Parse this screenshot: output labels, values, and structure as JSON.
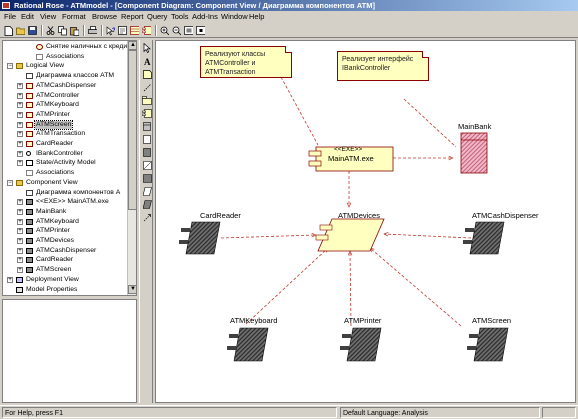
{
  "window": {
    "title": "Rational Rose - ATMmodel - [Component Diagram: Component View / Диаграмма компонентов ATM]"
  },
  "menu": [
    "File",
    "Edit",
    "View",
    "Format",
    "Browse",
    "Report",
    "Query",
    "Tools",
    "Add-Ins",
    "Window",
    "Help"
  ],
  "toolbar": {
    "buttons": [
      "new-icon",
      "open-icon",
      "save-icon",
      "cut-icon",
      "copy-icon",
      "paste-icon",
      "print-icon",
      "help-icon",
      "context-help-icon",
      "browse-icon",
      "class-diagram-icon",
      "component-diagram-icon",
      "zoom-in-icon",
      "zoom-out-icon",
      "fit-icon",
      "undo-fit-icon"
    ]
  },
  "browser": {
    "items": [
      {
        "label": "Снятие наличных с кредит",
        "level": 2,
        "icon": "usecase-icon"
      },
      {
        "label": "Associations",
        "level": 2,
        "icon": "association-icon"
      },
      {
        "label": "Logical View",
        "level": 0,
        "icon": "folder-icon",
        "expanded": true
      },
      {
        "label": "Диаграмма классов ATM",
        "level": 1,
        "icon": "class-diagram-icon"
      },
      {
        "label": "ATMCashDispenser",
        "level": 1,
        "icon": "class-icon"
      },
      {
        "label": "ATMController",
        "level": 1,
        "icon": "class-icon"
      },
      {
        "label": "ATMKeyboard",
        "level": 1,
        "icon": "class-icon"
      },
      {
        "label": "ATMPrinter",
        "level": 1,
        "icon": "class-icon"
      },
      {
        "label": "ATMScreen",
        "level": 1,
        "icon": "class-icon",
        "selected": true
      },
      {
        "label": "ATMTransaction",
        "level": 1,
        "icon": "class-icon"
      },
      {
        "label": "CardReader",
        "level": 1,
        "icon": "class-icon"
      },
      {
        "label": "IBankController",
        "level": 1,
        "icon": "interface-icon"
      },
      {
        "label": "State/Activity Model",
        "level": 1,
        "icon": "statechart-icon"
      },
      {
        "label": "Associations",
        "level": 1,
        "icon": "association-icon"
      },
      {
        "label": "Component View",
        "level": 0,
        "icon": "folder-icon",
        "expanded": true
      },
      {
        "label": "Диаграмма компонентов A",
        "level": 1,
        "icon": "component-diagram-icon"
      },
      {
        "label": "<<EXE>> MainATM.exe",
        "level": 1,
        "icon": "component-icon"
      },
      {
        "label": "MainBank",
        "level": 1,
        "icon": "component-icon"
      },
      {
        "label": "ATMKeyboard",
        "level": 1,
        "icon": "component-icon"
      },
      {
        "label": "ATMPrinter",
        "level": 1,
        "icon": "component-icon"
      },
      {
        "label": "ATMDevices",
        "level": 1,
        "icon": "component-icon"
      },
      {
        "label": "ATMCashDispenser",
        "level": 1,
        "icon": "component-icon"
      },
      {
        "label": "CardReader",
        "level": 1,
        "icon": "component-icon"
      },
      {
        "label": "ATMScreen",
        "level": 1,
        "icon": "component-icon"
      },
      {
        "label": "Deployment View",
        "level": 0,
        "icon": "deployment-icon"
      },
      {
        "label": "Model Properties",
        "level": 0,
        "icon": "properties-icon"
      }
    ]
  },
  "toolbox": [
    "selector-icon",
    "text-icon",
    "note-icon",
    "anchor-icon",
    "package-icon",
    "component-icon",
    "main-program-icon",
    "subprogram-spec-icon",
    "subprogram-body-icon",
    "package-spec-icon",
    "package-body-icon",
    "task-spec-icon",
    "task-body-icon",
    "dependency-icon",
    "generic-package-icon",
    "database-icon"
  ],
  "diagram": {
    "notes": [
      {
        "id": "note-atm-classes",
        "text_lines": [
          "Реализуют классы",
          "ATMController и",
          "ATMTransaction"
        ]
      },
      {
        "id": "note-bank-interface",
        "text_lines": [
          "Реализует интерфейс",
          "IBankController"
        ]
      }
    ],
    "components": {
      "main_exe_stereotype": "<<EXE>>",
      "main_exe_name": "MainATM.exe",
      "main_bank": "MainBank",
      "atm_devices": "ATMDevices",
      "card_reader": "CardReader",
      "cash_dispenser": "ATMCashDispenser",
      "keyboard": "ATMKeyboard",
      "printer": "ATMPrinter",
      "screen": "ATMScreen"
    }
  },
  "status": {
    "help": "For Help, press F1",
    "language": "Default Language: Analysis"
  },
  "colors": {
    "title_bar": "#0a246a",
    "dependency_line": "#c0392b",
    "note_fill": "#ffffc0",
    "component_fill": "#ffffc0",
    "mainbank_fill": "#f2b8c6"
  }
}
